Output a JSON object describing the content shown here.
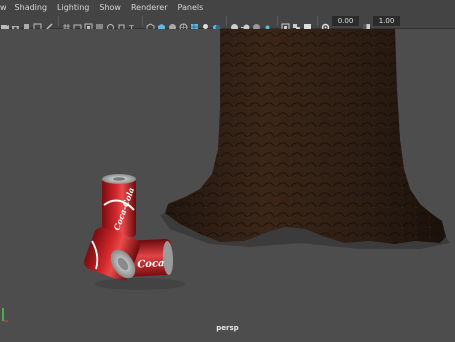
{
  "menu": {
    "items": [
      "w",
      "Shading",
      "Lighting",
      "Show",
      "Renderer",
      "Panels"
    ]
  },
  "toolbar": {
    "exposure_value": "0.00",
    "gamma_value": "1.00",
    "accent_color": "#5fb7e8"
  },
  "viewport": {
    "camera_label": "persp",
    "background_color": "#4d4d4d"
  },
  "scene": {
    "objects": [
      "tree-trunk",
      "soda-can-upright",
      "soda-can-lying",
      "soda-can-back"
    ],
    "can_brand_text": "Coca-Cola"
  }
}
